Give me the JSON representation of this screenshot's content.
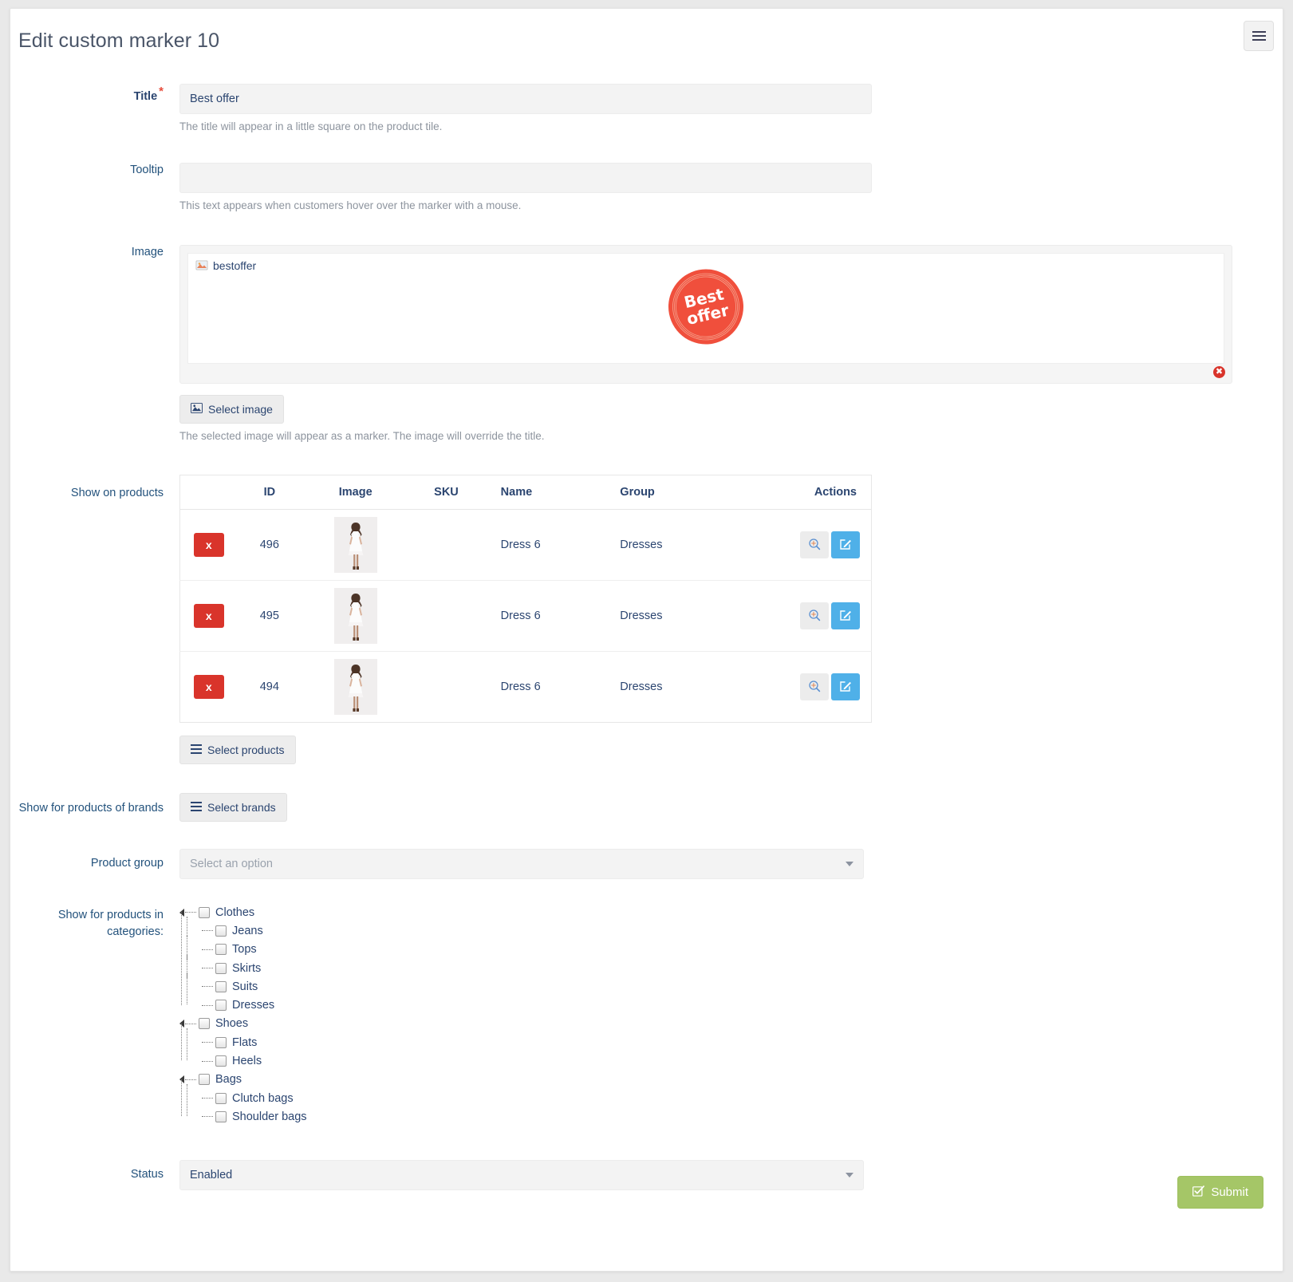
{
  "header": {
    "title": "Edit custom marker 10",
    "menu_icon": "hamburger-menu-icon"
  },
  "form": {
    "title_field": {
      "label": "Title",
      "required_mark": "*",
      "value": "Best offer",
      "placeholder": "",
      "help": "The title will appear in a little square on the product tile."
    },
    "tooltip_field": {
      "label": "Tooltip",
      "value": "",
      "placeholder": "",
      "help": "This text appears when customers hover over the marker with a mouse."
    },
    "image_field": {
      "label": "Image",
      "filename": "bestoffer",
      "file_icon": "image-file-icon",
      "remove_icon": "remove-circle-icon",
      "badge_line1": "Best",
      "badge_line2": "offer",
      "badge_color": "#f04f3c",
      "select_button": {
        "label": "Select image",
        "icon": "picture-icon"
      },
      "help": "The selected image will appear as a marker. The image will override the title."
    },
    "products_field": {
      "label": "Show on products",
      "columns": [
        "",
        "ID",
        "Image",
        "SKU",
        "Name",
        "Group",
        "Actions"
      ],
      "rows": [
        {
          "remove_label": "x",
          "id": "496",
          "sku": "",
          "name": "Dress 6",
          "group": "Dresses",
          "view_icon": "magnifier-plus-icon",
          "edit_icon": "edit-square-icon",
          "thumb_alt": "dress-thumbnail"
        },
        {
          "remove_label": "x",
          "id": "495",
          "sku": "",
          "name": "Dress 6",
          "group": "Dresses",
          "view_icon": "magnifier-plus-icon",
          "edit_icon": "edit-square-icon",
          "thumb_alt": "dress-thumbnail"
        },
        {
          "remove_label": "x",
          "id": "494",
          "sku": "",
          "name": "Dress 6",
          "group": "Dresses",
          "view_icon": "magnifier-plus-icon",
          "edit_icon": "edit-square-icon",
          "thumb_alt": "dress-thumbnail"
        }
      ],
      "select_button": {
        "label": "Select products",
        "icon": "list-icon"
      }
    },
    "brands_field": {
      "label": "Show for products of brands",
      "select_button": {
        "label": "Select brands",
        "icon": "list-icon"
      }
    },
    "product_group_field": {
      "label": "Product group",
      "value": "Select an option",
      "is_placeholder": true,
      "caret_icon": "chevron-down-icon"
    },
    "categories_field": {
      "label": "Show for products in categories:",
      "tree": [
        {
          "label": "Clothes",
          "level": 0,
          "expander": true,
          "children": [
            {
              "label": "Jeans",
              "level": 1
            },
            {
              "label": "Tops",
              "level": 1
            },
            {
              "label": "Skirts",
              "level": 1
            },
            {
              "label": "Suits",
              "level": 1
            },
            {
              "label": "Dresses",
              "level": 1
            }
          ]
        },
        {
          "label": "Shoes",
          "level": 0,
          "expander": true,
          "children": [
            {
              "label": "Flats",
              "level": 1
            },
            {
              "label": "Heels",
              "level": 1
            }
          ]
        },
        {
          "label": "Bags",
          "level": 0,
          "expander": true,
          "children": [
            {
              "label": "Clutch bags",
              "level": 1
            },
            {
              "label": "Shoulder bags",
              "level": 1
            }
          ]
        }
      ]
    },
    "status_field": {
      "label": "Status",
      "value": "Enabled",
      "caret_icon": "chevron-down-icon"
    }
  },
  "footer": {
    "submit": {
      "label": "Submit",
      "icon": "check-square-icon",
      "color": "#a5c667"
    }
  }
}
